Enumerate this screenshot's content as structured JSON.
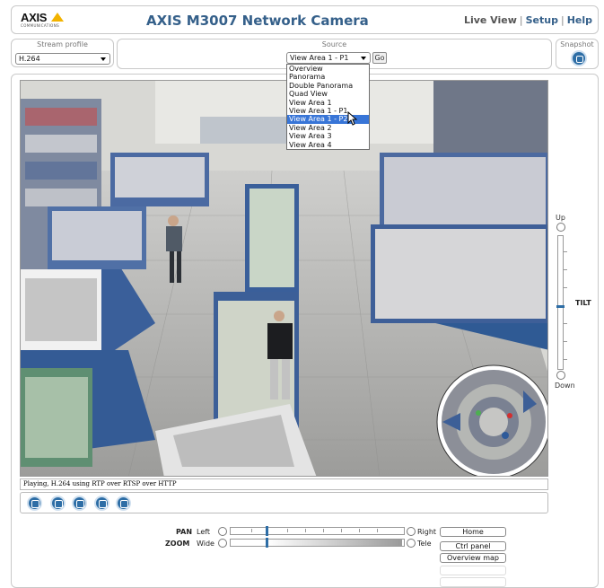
{
  "header": {
    "logo_text": "AXIS",
    "logo_tagline": "COMMUNICATIONS",
    "title": "AXIS M3007 Network Camera",
    "nav": [
      "Live View",
      "Setup",
      "Help"
    ]
  },
  "stream_profile": {
    "title": "Stream profile",
    "value": "H.264"
  },
  "source": {
    "title": "Source",
    "value": "View Area 1 - P1",
    "go_label": "Go",
    "options": [
      "Overview",
      "Panorama",
      "Double Panorama",
      "Quad View",
      "View Area 1",
      "View Area 1 - P1",
      "View Area 1 - P2",
      "View Area 2",
      "View Area 3",
      "View Area 4"
    ],
    "highlighted": "View Area 1 - P2"
  },
  "snapshot": {
    "title": "Snapshot",
    "icon": "camera-icon"
  },
  "video": {
    "status": "Playing, H.264 using RTP over RTSP over HTTP",
    "toolbar_icons": [
      "stop-icon",
      "record-icon",
      "fullscreen-icon",
      "edit-icon",
      "audio-icon"
    ]
  },
  "tilt": {
    "up_label": "Up",
    "down_label": "Down",
    "label": "TILT",
    "level": 0.52
  },
  "pan": {
    "label": "PAN",
    "left_label": "Left",
    "right_label": "Right",
    "level": 0.22
  },
  "zoom": {
    "label": "ZOOM",
    "wide_label": "Wide",
    "tele_label": "Tele",
    "level": 0.22
  },
  "side_buttons": [
    "Home",
    "Ctrl panel",
    "Overview map"
  ],
  "colors": {
    "brand_blue": "#35608a",
    "accent_yellow": "#f2b300",
    "highlight": "#3875d7"
  }
}
